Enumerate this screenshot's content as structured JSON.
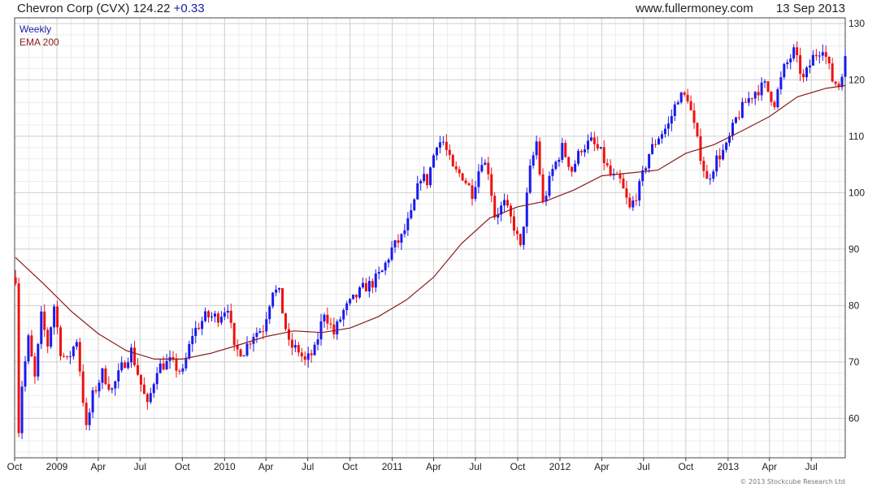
{
  "header": {
    "title": "Chevron Corp (CVX)",
    "price": "124.22",
    "change": "+0.33",
    "site": "www.fullermoney.com",
    "date": "13 Sep 2013"
  },
  "legend": {
    "weekly": "Weekly",
    "ema": "EMA 200"
  },
  "copyright": "© 2013 Stockcube Research Ltd",
  "colors": {
    "up": "#1a1aee",
    "down": "#ee1111",
    "ema": "#8b1a1a",
    "grid_major": "#cfcfcf",
    "grid_minor": "#ececec"
  },
  "chart_data": {
    "type": "candlestick",
    "xlabel": "",
    "ylabel": "",
    "ylim": [
      53,
      131
    ],
    "y_ticks": [
      60,
      70,
      80,
      90,
      100,
      110,
      120,
      130
    ],
    "x_start": "2008-10-01",
    "x_end": "2013-09-13",
    "x_ticks": [
      {
        "date": "2008-10-01",
        "label": "Oct"
      },
      {
        "date": "2009-01-01",
        "label": "2009"
      },
      {
        "date": "2009-04-01",
        "label": "Apr"
      },
      {
        "date": "2009-07-01",
        "label": "Jul"
      },
      {
        "date": "2009-10-01",
        "label": "Oct"
      },
      {
        "date": "2010-01-01",
        "label": "2010"
      },
      {
        "date": "2010-04-01",
        "label": "Apr"
      },
      {
        "date": "2010-07-01",
        "label": "Jul"
      },
      {
        "date": "2010-10-01",
        "label": "Oct"
      },
      {
        "date": "2011-01-01",
        "label": "2011"
      },
      {
        "date": "2011-04-01",
        "label": "Apr"
      },
      {
        "date": "2011-07-01",
        "label": "Jul"
      },
      {
        "date": "2011-10-01",
        "label": "Oct"
      },
      {
        "date": "2012-01-01",
        "label": "2012"
      },
      {
        "date": "2012-04-01",
        "label": "Apr"
      },
      {
        "date": "2012-07-01",
        "label": "Jul"
      },
      {
        "date": "2012-10-01",
        "label": "Oct"
      },
      {
        "date": "2013-01-01",
        "label": "2013"
      },
      {
        "date": "2013-04-01",
        "label": "Apr"
      },
      {
        "date": "2013-07-01",
        "label": "Jul"
      }
    ],
    "close_path": [
      [
        "2008-10-03",
        85
      ],
      [
        "2008-10-10",
        58
      ],
      [
        "2008-10-17",
        66
      ],
      [
        "2008-10-31",
        74
      ],
      [
        "2008-11-14",
        67
      ],
      [
        "2008-11-28",
        78
      ],
      [
        "2008-12-12",
        73
      ],
      [
        "2008-12-26",
        80
      ],
      [
        "2009-01-09",
        72
      ],
      [
        "2009-01-23",
        70
      ],
      [
        "2009-02-13",
        74
      ],
      [
        "2009-03-06",
        58
      ],
      [
        "2009-03-20",
        64
      ],
      [
        "2009-04-10",
        68
      ],
      [
        "2009-05-01",
        65
      ],
      [
        "2009-05-22",
        69
      ],
      [
        "2009-06-12",
        72
      ],
      [
        "2009-07-03",
        66
      ],
      [
        "2009-07-17",
        62
      ],
      [
        "2009-08-07",
        69
      ],
      [
        "2009-09-04",
        70
      ],
      [
        "2009-10-02",
        68
      ],
      [
        "2009-10-23",
        75
      ],
      [
        "2009-11-20",
        78
      ],
      [
        "2009-12-18",
        78
      ],
      [
        "2010-01-08",
        80
      ],
      [
        "2010-01-22",
        72
      ],
      [
        "2010-02-12",
        72
      ],
      [
        "2010-03-05",
        75
      ],
      [
        "2010-03-26",
        76
      ],
      [
        "2010-04-16",
        83
      ],
      [
        "2010-04-30",
        82
      ],
      [
        "2010-05-21",
        73
      ],
      [
        "2010-06-11",
        72
      ],
      [
        "2010-06-25",
        70
      ],
      [
        "2010-07-16",
        72
      ],
      [
        "2010-08-06",
        79
      ],
      [
        "2010-08-27",
        75
      ],
      [
        "2010-09-17",
        79
      ],
      [
        "2010-10-08",
        81
      ],
      [
        "2010-10-29",
        83
      ],
      [
        "2010-11-19",
        84
      ],
      [
        "2010-12-10",
        86
      ],
      [
        "2010-12-31",
        90
      ],
      [
        "2011-01-21",
        92
      ],
      [
        "2011-02-11",
        96
      ],
      [
        "2011-03-04",
        103
      ],
      [
        "2011-03-18",
        102
      ],
      [
        "2011-04-08",
        109
      ],
      [
        "2011-04-22",
        109
      ],
      [
        "2011-05-13",
        104
      ],
      [
        "2011-06-03",
        103
      ],
      [
        "2011-06-24",
        100
      ],
      [
        "2011-07-15",
        106
      ],
      [
        "2011-07-29",
        104
      ],
      [
        "2011-08-12",
        96
      ],
      [
        "2011-09-02",
        98
      ],
      [
        "2011-09-23",
        94
      ],
      [
        "2011-10-07",
        90
      ],
      [
        "2011-10-28",
        104
      ],
      [
        "2011-11-11",
        109
      ],
      [
        "2011-11-25",
        98
      ],
      [
        "2011-12-16",
        104
      ],
      [
        "2012-01-06",
        108
      ],
      [
        "2012-01-27",
        104
      ],
      [
        "2012-02-17",
        108
      ],
      [
        "2012-03-09",
        109
      ],
      [
        "2012-03-30",
        107
      ],
      [
        "2012-04-20",
        103
      ],
      [
        "2012-05-11",
        102
      ],
      [
        "2012-06-01",
        97
      ],
      [
        "2012-06-22",
        101
      ],
      [
        "2012-07-13",
        107
      ],
      [
        "2012-08-03",
        110
      ],
      [
        "2012-08-24",
        112
      ],
      [
        "2012-09-14",
        117
      ],
      [
        "2012-10-05",
        117
      ],
      [
        "2012-10-26",
        109
      ],
      [
        "2012-11-16",
        102
      ],
      [
        "2012-12-07",
        106
      ],
      [
        "2012-12-28",
        108
      ],
      [
        "2013-01-18",
        113
      ],
      [
        "2013-02-08",
        116
      ],
      [
        "2013-03-01",
        118
      ],
      [
        "2013-03-22",
        119
      ],
      [
        "2013-04-12",
        116
      ],
      [
        "2013-05-03",
        122
      ],
      [
        "2013-05-24",
        125
      ],
      [
        "2013-06-14",
        120
      ],
      [
        "2013-07-05",
        124
      ],
      [
        "2013-07-26",
        126
      ],
      [
        "2013-08-16",
        120
      ],
      [
        "2013-08-30",
        119
      ],
      [
        "2013-09-13",
        124.22
      ]
    ],
    "ema_200": [
      [
        "2008-10-03",
        88.5
      ],
      [
        "2008-12-01",
        84
      ],
      [
        "2009-02-01",
        79
      ],
      [
        "2009-04-01",
        75
      ],
      [
        "2009-06-01",
        72
      ],
      [
        "2009-08-01",
        70.5
      ],
      [
        "2009-10-01",
        70.5
      ],
      [
        "2009-12-01",
        71.5
      ],
      [
        "2010-02-01",
        73
      ],
      [
        "2010-04-01",
        74.5
      ],
      [
        "2010-06-01",
        75.5
      ],
      [
        "2010-08-01",
        75.2
      ],
      [
        "2010-10-01",
        76
      ],
      [
        "2010-12-01",
        78
      ],
      [
        "2011-02-01",
        81
      ],
      [
        "2011-04-01",
        85
      ],
      [
        "2011-06-01",
        91
      ],
      [
        "2011-08-01",
        95.5
      ],
      [
        "2011-10-01",
        97.5
      ],
      [
        "2011-12-01",
        98.5
      ],
      [
        "2012-02-01",
        100.5
      ],
      [
        "2012-04-01",
        103
      ],
      [
        "2012-06-01",
        103.5
      ],
      [
        "2012-08-01",
        104
      ],
      [
        "2012-10-01",
        107
      ],
      [
        "2012-12-01",
        108.5
      ],
      [
        "2013-02-01",
        111
      ],
      [
        "2013-04-01",
        113.5
      ],
      [
        "2013-06-01",
        117
      ],
      [
        "2013-08-01",
        118.5
      ],
      [
        "2013-09-13",
        119
      ]
    ]
  }
}
